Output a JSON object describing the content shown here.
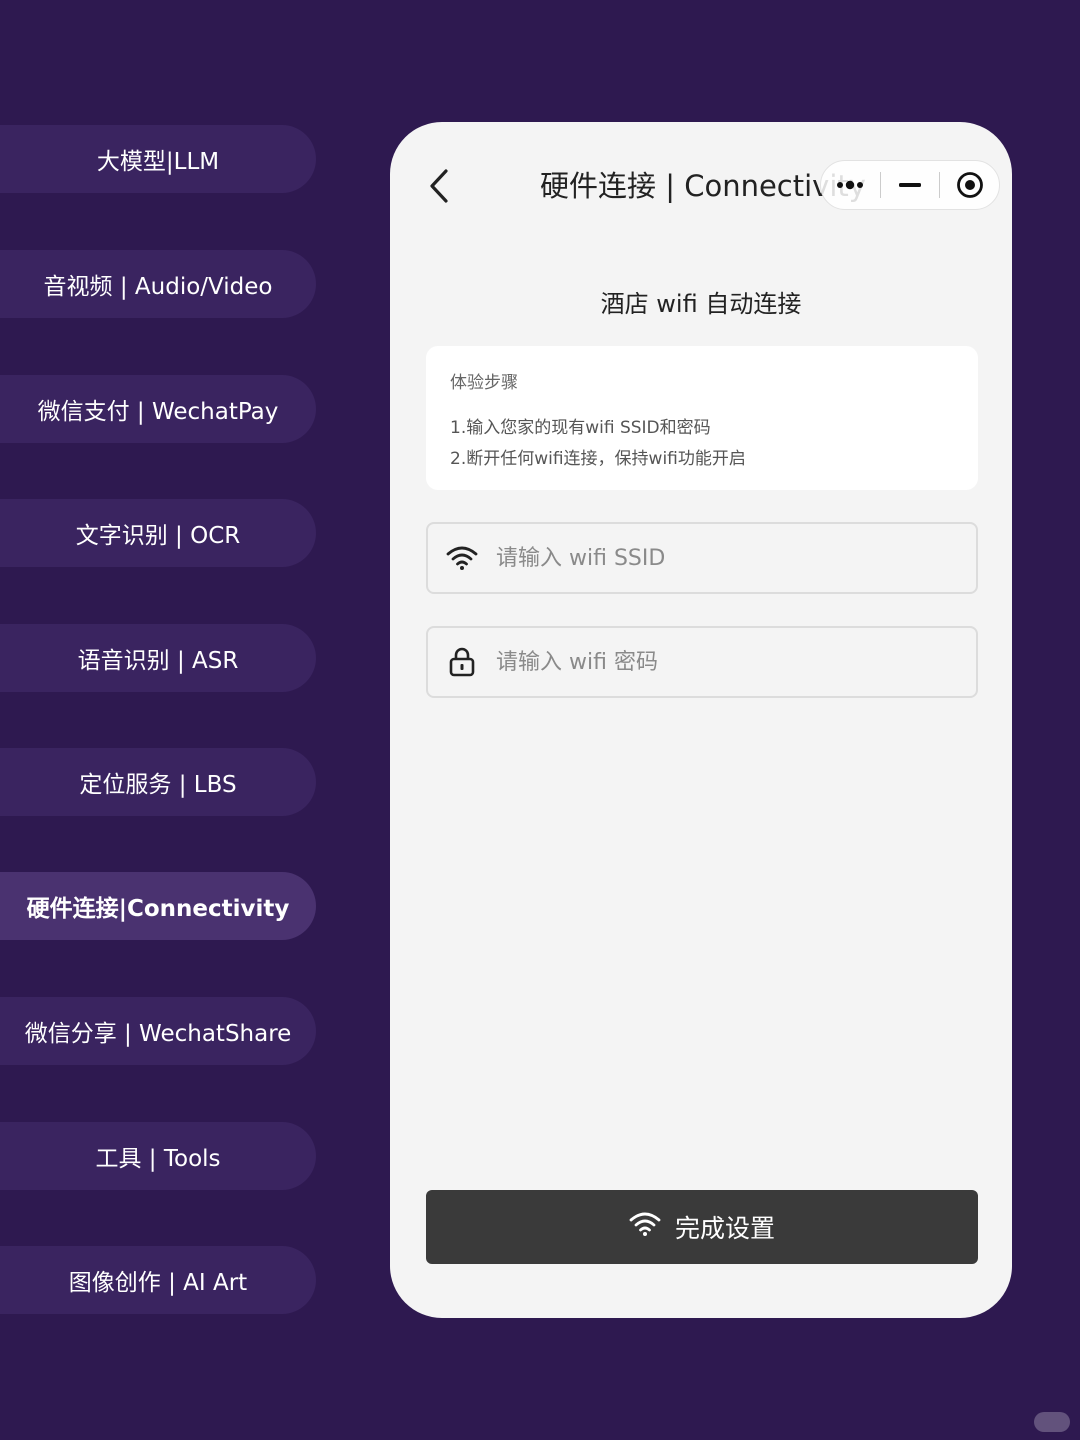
{
  "sidebar": {
    "items": [
      {
        "label": "大模型|LLM"
      },
      {
        "label": "音视频 | Audio/Video"
      },
      {
        "label": "微信支付 | WechatPay"
      },
      {
        "label": "文字识别 | OCR"
      },
      {
        "label": "语音识别 | ASR"
      },
      {
        "label": "定位服务 | LBS"
      },
      {
        "label": "硬件连接|Connectivity"
      },
      {
        "label": "微信分享 | WechatShare"
      },
      {
        "label": "工具 | Tools"
      },
      {
        "label": "图像创作 | AI Art"
      }
    ],
    "active_index": 6
  },
  "phone": {
    "nav_title": "硬件连接 | Connectivity",
    "heading": "酒店 wifi 自动连接",
    "steps": {
      "title": "体验步骤",
      "items": [
        "1.输入您家的现有wifi SSID和密码",
        "2.断开任何wifi连接，保持wifi功能开启"
      ]
    },
    "ssid_field": {
      "placeholder": "请输入 wifi SSID",
      "value": "",
      "icon": "wifi-icon"
    },
    "password_field": {
      "placeholder": "请输入 wifi 密码",
      "value": "",
      "icon": "lock-icon"
    },
    "submit": {
      "label": "完成设置",
      "icon": "wifi-icon"
    }
  },
  "colors": {
    "background": "#2e1950",
    "menu_item": "#3a2460",
    "menu_item_active": "#4a3270",
    "phone_bg": "#f4f4f4",
    "button_dark": "#3a3a3a"
  }
}
